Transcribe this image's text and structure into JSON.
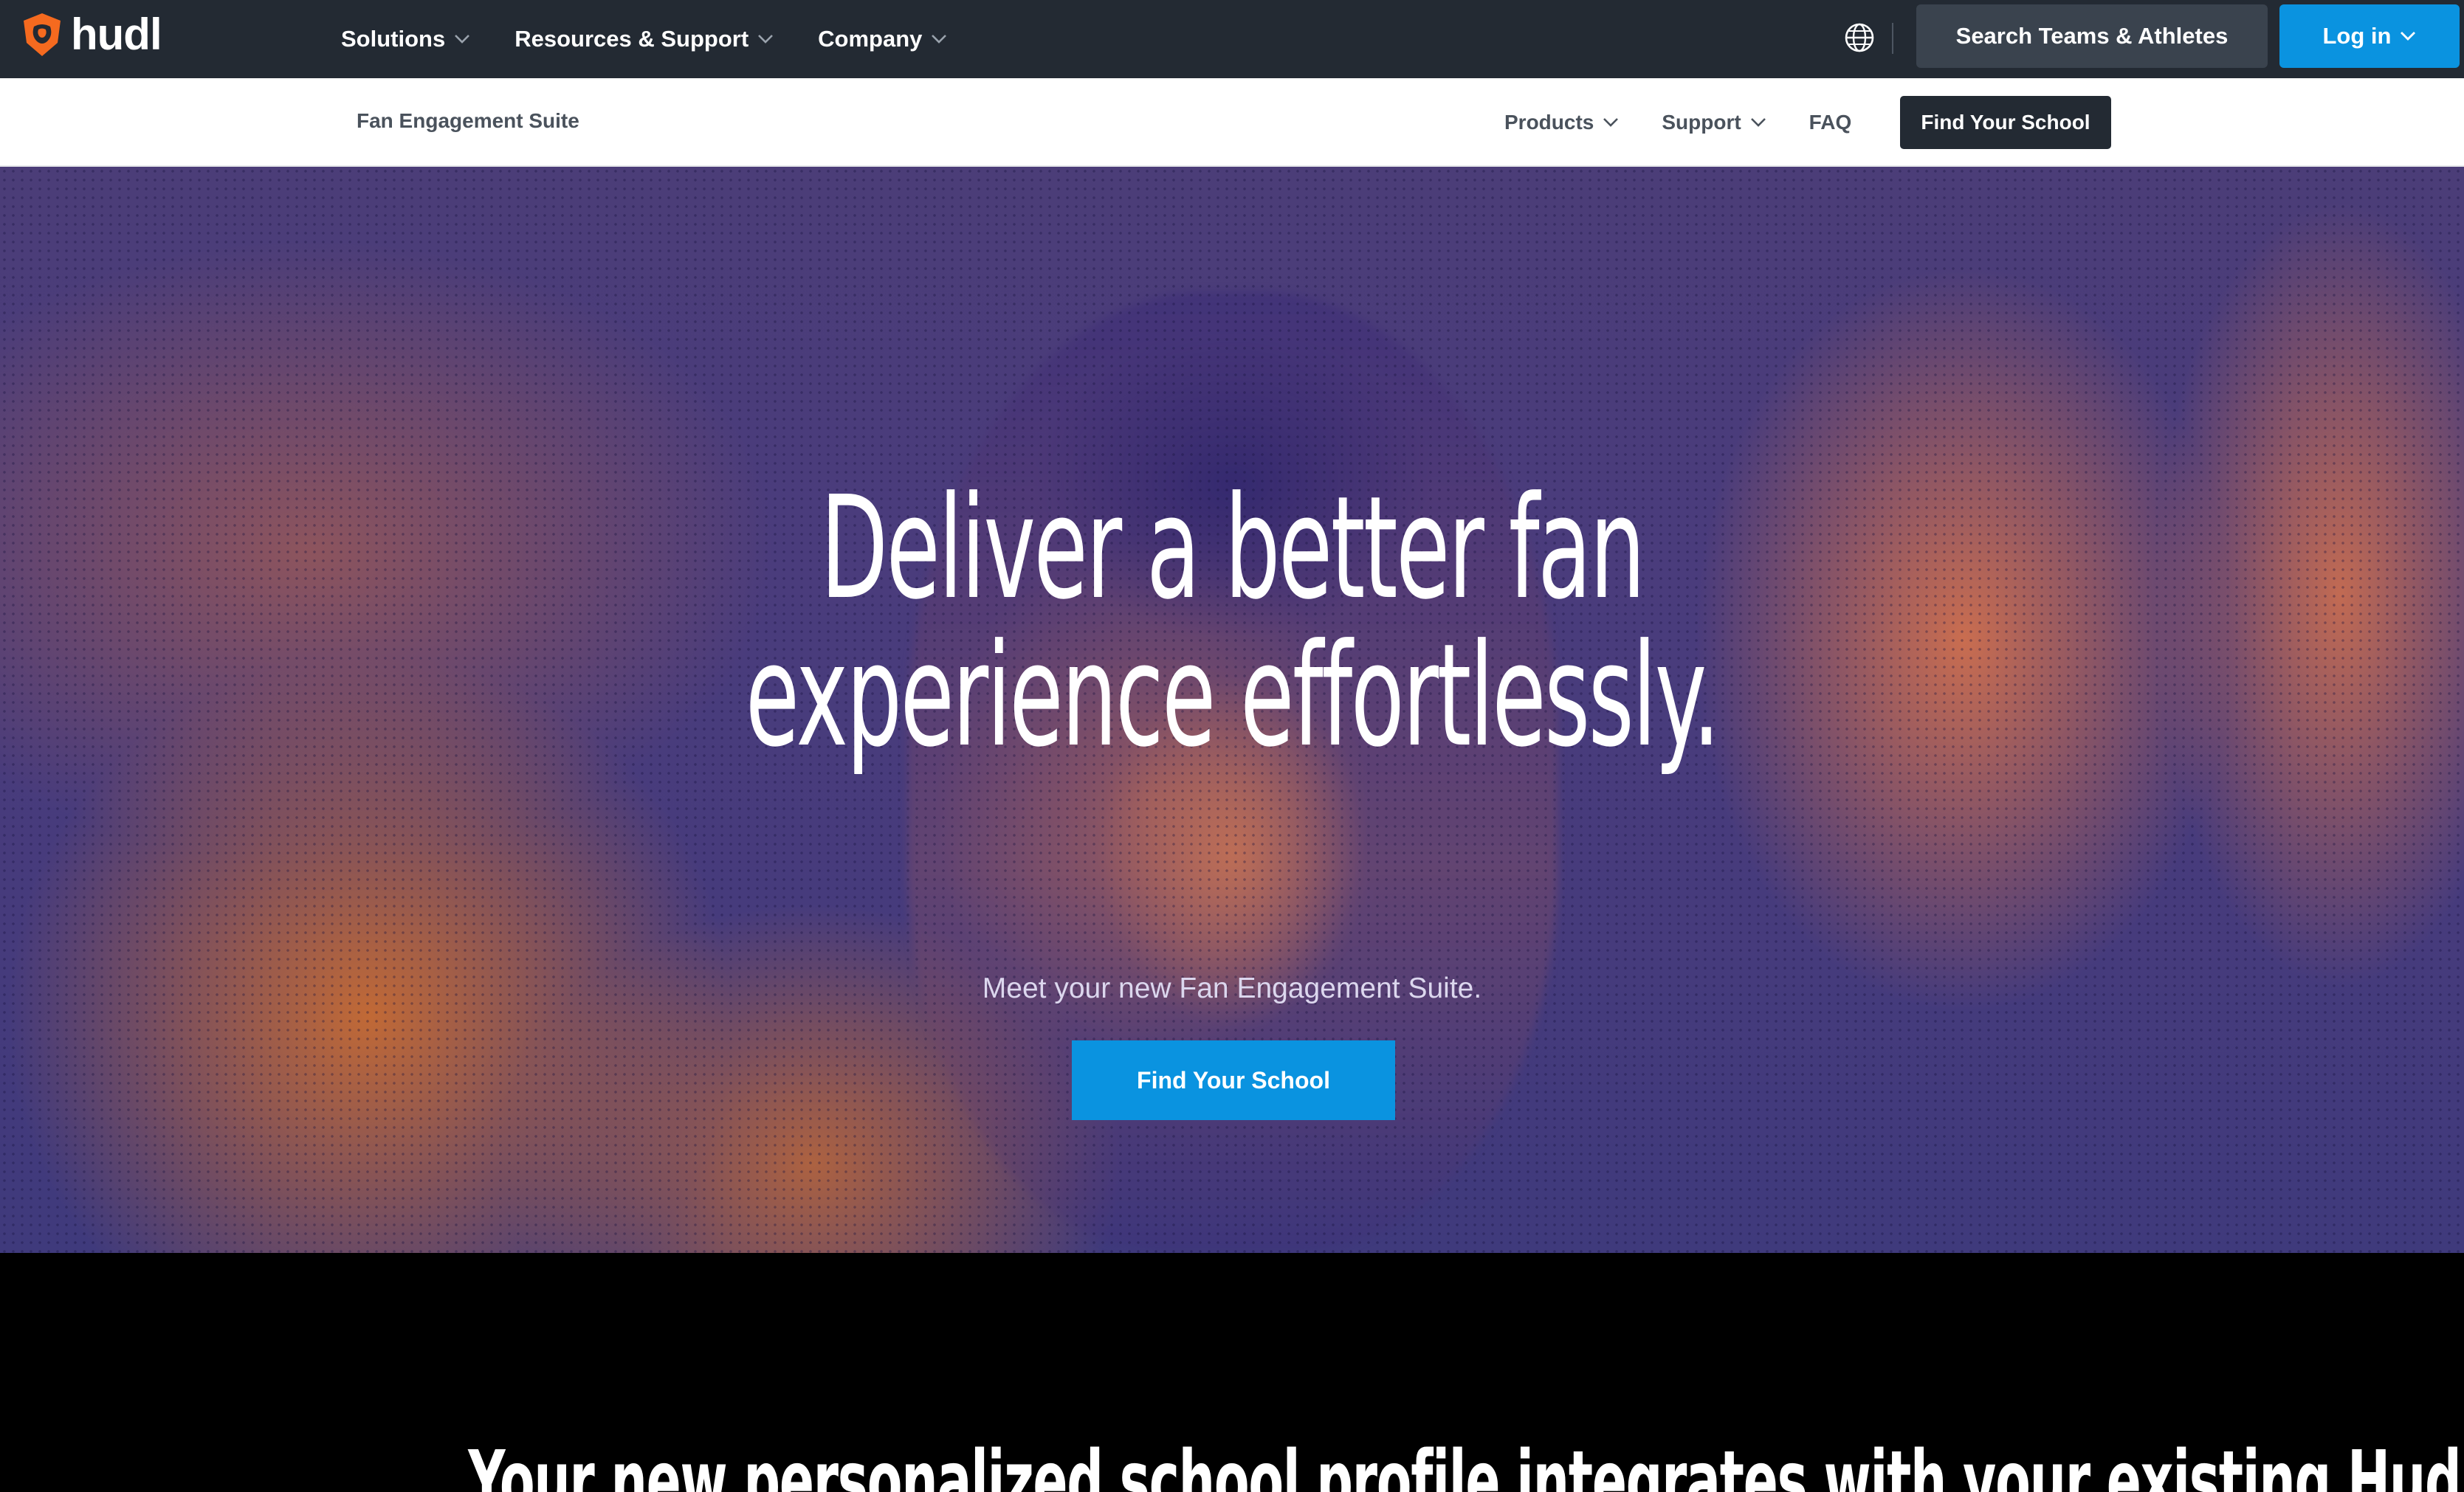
{
  "colors": {
    "topnav_bg": "#232a33",
    "accent_blue": "#0a93e0",
    "brand_orange": "#f56a1f",
    "subnav_text": "#4a525c"
  },
  "topnav": {
    "logo_text": "hudl",
    "logo_icon": "hudl-shield-logo-icon",
    "menu": [
      {
        "label": "Solutions",
        "icon": "chevron-down-icon"
      },
      {
        "label": "Resources & Support",
        "icon": "chevron-down-icon"
      },
      {
        "label": "Company",
        "icon": "chevron-down-icon"
      }
    ],
    "globe_icon": "globe-icon",
    "search_label": "Search Teams & Athletes",
    "login_label": "Log in"
  },
  "subnav": {
    "title": "Fan Engagement Suite",
    "menu": [
      {
        "label": "Products",
        "icon": "chevron-down-icon"
      },
      {
        "label": "Support",
        "icon": "chevron-down-icon"
      },
      {
        "label": "FAQ"
      }
    ],
    "cta_label": "Find Your School"
  },
  "hero": {
    "headline_line1": "Deliver a better fan",
    "headline_line2": "experience effortlessly.",
    "subtitle": "Meet your new Fan Engagement Suite.",
    "cta_label": "Find Your School"
  },
  "section2": {
    "heading": "Your new personalized school profile integrates with your existing Hudl"
  }
}
